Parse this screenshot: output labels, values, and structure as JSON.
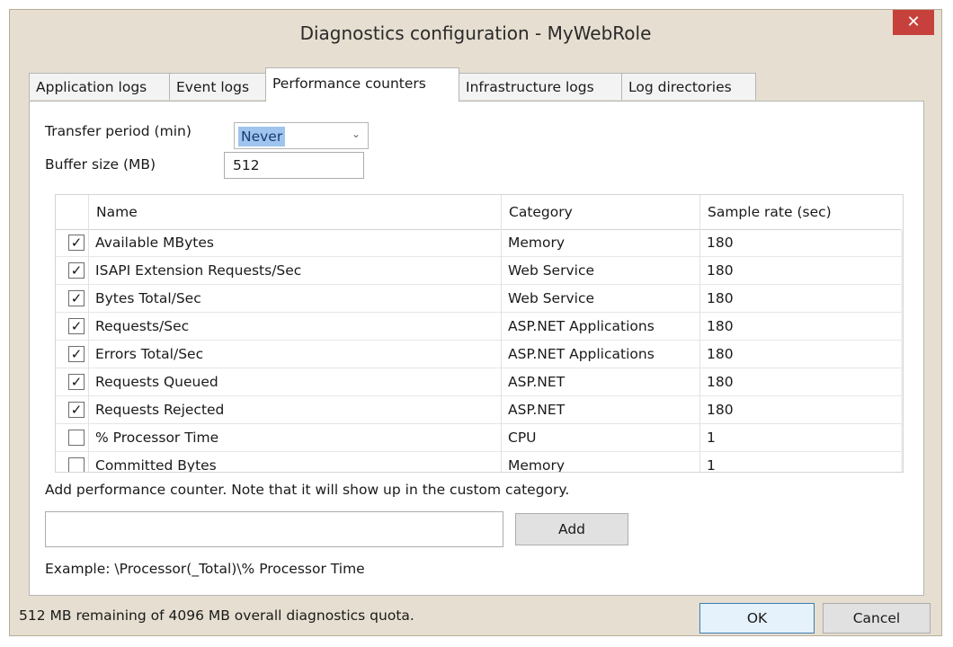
{
  "window": {
    "title": "Diagnostics configuration - MyWebRole",
    "close_glyph": "✕"
  },
  "tabs": [
    {
      "label": "Application logs",
      "active": false
    },
    {
      "label": "Event logs",
      "active": false
    },
    {
      "label": "Performance counters",
      "active": true
    },
    {
      "label": "Infrastructure logs",
      "active": false
    },
    {
      "label": "Log directories",
      "active": false
    }
  ],
  "settings": {
    "transfer_period_label": "Transfer period (min)",
    "transfer_period_value": "Never",
    "buffer_size_label": "Buffer size (MB)",
    "buffer_size_value": "512"
  },
  "counters": {
    "columns": [
      "Name",
      "Category",
      "Sample rate (sec)"
    ],
    "rows": [
      {
        "checked": true,
        "name": "Available MBytes",
        "category": "Memory",
        "rate": "180"
      },
      {
        "checked": true,
        "name": "ISAPI Extension Requests/Sec",
        "category": "Web Service",
        "rate": "180"
      },
      {
        "checked": true,
        "name": "Bytes Total/Sec",
        "category": "Web Service",
        "rate": "180"
      },
      {
        "checked": true,
        "name": "Requests/Sec",
        "category": "ASP.NET Applications",
        "rate": "180"
      },
      {
        "checked": true,
        "name": "Errors Total/Sec",
        "category": "ASP.NET Applications",
        "rate": "180"
      },
      {
        "checked": true,
        "name": "Requests Queued",
        "category": "ASP.NET",
        "rate": "180"
      },
      {
        "checked": true,
        "name": "Requests Rejected",
        "category": "ASP.NET",
        "rate": "180"
      },
      {
        "checked": false,
        "name": "% Processor Time",
        "category": "CPU",
        "rate": "1"
      },
      {
        "checked": false,
        "name": "Committed Bytes",
        "category": "Memory",
        "rate": "1"
      }
    ]
  },
  "add_counter": {
    "hint": "Add performance counter.  Note that it will show up in the custom category.",
    "input_value": "",
    "add_label": "Add",
    "example": "Example: \\Processor(_Total)\\% Processor Time"
  },
  "footer": {
    "quota_text": "512 MB remaining of 4096 MB overall diagnostics quota.",
    "ok_label": "OK",
    "cancel_label": "Cancel"
  },
  "icons": {
    "check": "✓",
    "chevron_down": "⌄",
    "scroll_up": "^",
    "scroll_down": "⌄"
  }
}
